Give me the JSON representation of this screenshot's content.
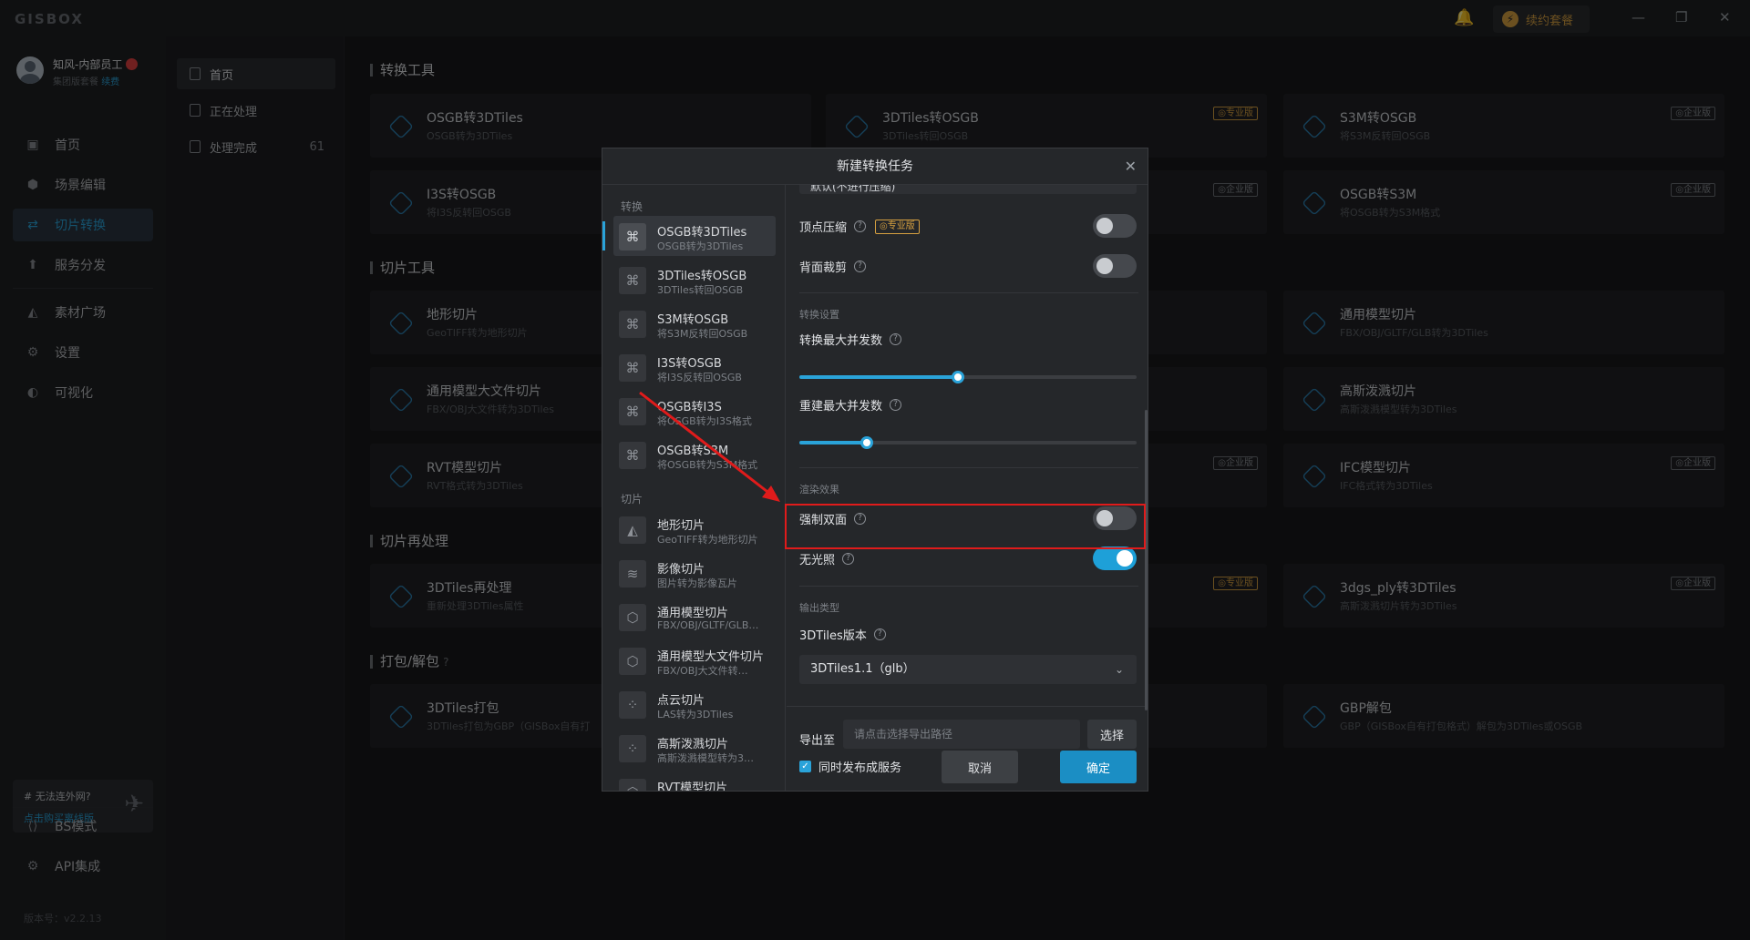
{
  "titlebar": {
    "logo": "GISBOX",
    "renew_label": "续约套餐",
    "bolt": "⚡",
    "bell": "🔔",
    "minimize": "—",
    "restore": "❐",
    "close": "✕"
  },
  "user": {
    "name": "知风-内部员工",
    "plan": "集团版套餐",
    "renew_link": "续费"
  },
  "sidebar": {
    "items": [
      {
        "label": "首页",
        "icon": "▣"
      },
      {
        "label": "场景编辑",
        "icon": "⬢"
      },
      {
        "label": "切片转换",
        "icon": "⇄"
      },
      {
        "label": "服务分发",
        "icon": "⬆"
      },
      {
        "label": "素材广场",
        "icon": "◭"
      },
      {
        "label": "设置",
        "icon": "⚙"
      },
      {
        "label": "可视化",
        "icon": "◐"
      }
    ],
    "offline_title": "# 无法连外网?",
    "offline_link": "点击购买离线版",
    "bottom_items": [
      {
        "label": "BS模式",
        "icon": "⟨⟩"
      },
      {
        "label": "API集成",
        "icon": "⚙"
      }
    ],
    "version": "版本号：v2.2.13"
  },
  "col2": {
    "items": [
      {
        "label": "首页",
        "count": ""
      },
      {
        "label": "正在处理",
        "count": ""
      },
      {
        "label": "处理完成",
        "count": "61"
      }
    ]
  },
  "main": {
    "sections": [
      {
        "title": "转换工具"
      },
      {
        "title": "切片工具"
      },
      {
        "title": "切片再处理"
      },
      {
        "title": "打包/解包",
        "help": "?"
      }
    ],
    "cards": [
      {
        "name": "OSGB转3DTiles",
        "desc": "OSGB转为3DTiles",
        "tag": ""
      },
      {
        "name": "3DTiles转OSGB",
        "desc": "3DTiles转回OSGB",
        "tag": "◎专业版"
      },
      {
        "name": "S3M转OSGB",
        "desc": "将S3M反转回OSGB",
        "tag": "◎企业版"
      },
      {
        "name": "I3S转OSGB",
        "desc": "将I3S反转回OSGB",
        "tag": ""
      },
      {
        "name": "",
        "desc": "",
        "tag": "◎企业版"
      },
      {
        "name": "OSGB转S3M",
        "desc": "将OSGB转为S3M格式",
        "tag": "◎企业版"
      },
      {
        "name": "地形切片",
        "desc": "GeoTIFF转为地形切片",
        "tag": ""
      },
      {
        "name": "通用模型切片",
        "desc": "FBX/OBJ/GLTF/GLB转为3DTiles",
        "tag": ""
      },
      {
        "name": "通用模型大文件切片",
        "desc": "FBX/OBJ大文件转为3DTiles",
        "tag": ""
      },
      {
        "name": "高斯泼溅切片",
        "desc": "高斯泼溅模型转为3DTiles",
        "tag": ""
      },
      {
        "name": "RVT模型切片",
        "desc": "RVT格式转为3DTiles",
        "tag": ""
      },
      {
        "name": "",
        "desc": "",
        "tag": "◎企业版"
      },
      {
        "name": "IFC模型切片",
        "desc": "IFC格式转为3DTiles",
        "tag": "◎企业版"
      },
      {
        "name": "3DTiles再处理",
        "desc": "重新处理3DTiles属性",
        "tag": ""
      },
      {
        "name": "",
        "desc": "",
        "tag": "◎专业版"
      },
      {
        "name": "3dgs_ply转3DTiles",
        "desc": "高斯泼溅切片转为3DTiles",
        "tag": "◎企业版"
      },
      {
        "name": "3DTiles打包",
        "desc": "3DTiles打包为GBP（GISBox自有打",
        "tag": ""
      },
      {
        "name": "GBP解包",
        "desc": "GBP（GISBox自有打包格式）解包为3DTiles或OSGB",
        "tag": ""
      }
    ]
  },
  "dialog": {
    "title": "新建转换任务",
    "close": "✕",
    "groups": {
      "convert": "转换",
      "slice": "切片"
    },
    "list": [
      {
        "name": "OSGB转3DTiles",
        "desc": "OSGB转为3DTiles",
        "icon": "⌘"
      },
      {
        "name": "3DTiles转OSGB",
        "desc": "3DTiles转回OSGB",
        "icon": "⌘"
      },
      {
        "name": "S3M转OSGB",
        "desc": "将S3M反转回OSGB",
        "icon": "⌘"
      },
      {
        "name": "I3S转OSGB",
        "desc": "将I3S反转回OSGB",
        "icon": "⌘"
      },
      {
        "name": "OSGB转I3S",
        "desc": "将OSGB转为I3S格式",
        "icon": "⌘"
      },
      {
        "name": "OSGB转S3M",
        "desc": "将OSGB转为S3M格式",
        "icon": "⌘"
      },
      {
        "name": "地形切片",
        "desc": "GeoTIFF转为地形切片",
        "icon": "◭"
      },
      {
        "name": "影像切片",
        "desc": "图片转为影像瓦片",
        "icon": "≋"
      },
      {
        "name": "通用模型切片",
        "desc": "FBX/OBJ/GLTF/GLB…",
        "icon": "⬡"
      },
      {
        "name": "通用模型大文件切片",
        "desc": "FBX/OBJ大文件转…",
        "icon": "⬡"
      },
      {
        "name": "点云切片",
        "desc": "LAS转为3DTiles",
        "icon": "⁘"
      },
      {
        "name": "高斯泼溅切片",
        "desc": "高斯泼溅模型转为3…",
        "icon": "⁘"
      },
      {
        "name": "RVT模型切片",
        "desc": "",
        "icon": "⬡"
      }
    ],
    "settings": {
      "top_select_value": "默认(不进行压缩)",
      "vertex_compress": "顶点压缩",
      "pro_tag": "◎专业版",
      "backface_cull": "背面裁剪",
      "convert_settings": "转换设置",
      "max_convert_concurrency": "转换最大并发数",
      "max_convert_concurrency_value": 0.47,
      "max_rebuild_concurrency": "重建最大并发数",
      "max_rebuild_concurrency_value": 0.2,
      "render_effects": "渲染效果",
      "force_double_side": "强制双面",
      "no_lighting": "无光照",
      "output_type": "输出类型",
      "tiles_version": "3DTiles版本",
      "tiles_version_value": "3DTiles1.1（glb）",
      "help": "?"
    },
    "footer": {
      "export_label": "导出至",
      "export_placeholder": "请点击选择导出路径",
      "select_button": "选择",
      "publish_label": "同时发布成服务",
      "check": "✓",
      "cancel": "取消",
      "confirm": "确定"
    }
  }
}
